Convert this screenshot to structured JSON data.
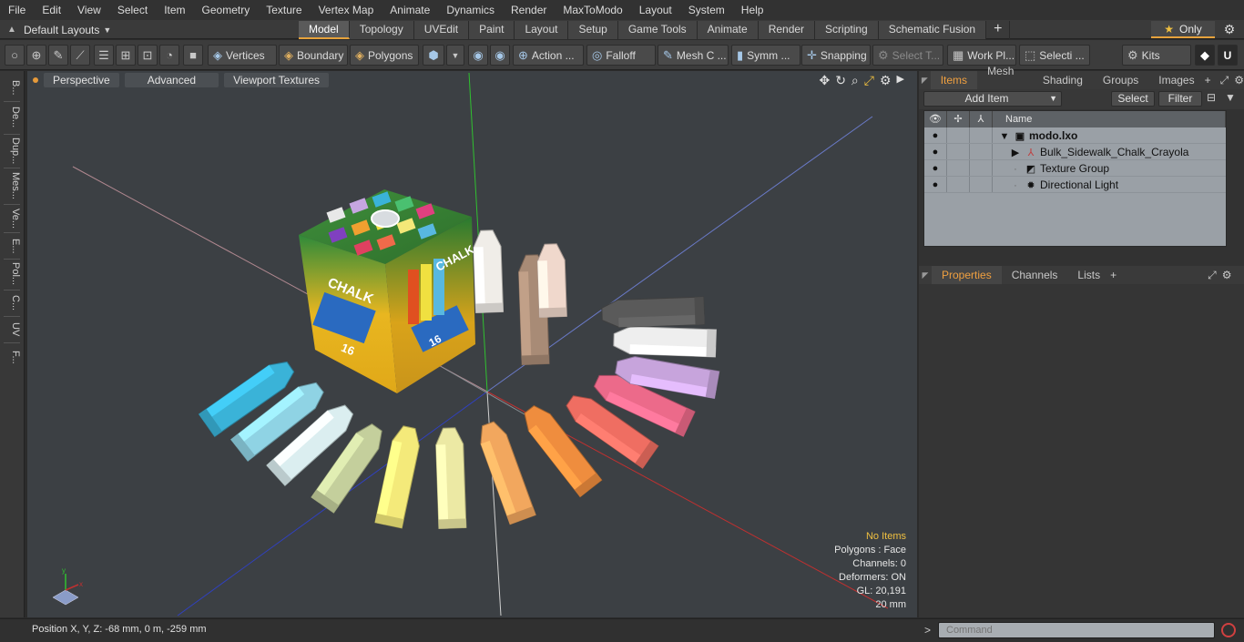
{
  "menu": [
    "File",
    "Edit",
    "View",
    "Select",
    "Item",
    "Geometry",
    "Texture",
    "Vertex Map",
    "Animate",
    "Dynamics",
    "Render",
    "MaxToModo",
    "Layout",
    "System",
    "Help"
  ],
  "layout_selector": "Default Layouts",
  "tabs": [
    "Model",
    "Topology",
    "UVEdit",
    "Paint",
    "Layout",
    "Setup",
    "Game Tools",
    "Animate",
    "Render",
    "Scripting",
    "Schematic Fusion"
  ],
  "active_tab": "Model",
  "only_label": "Only",
  "toolbar": {
    "vertices": "Vertices",
    "boundary": "Boundary",
    "polygons": "Polygons",
    "action": "Action ...",
    "falloff": "Falloff",
    "mesh": "Mesh C ...",
    "symm": "Symm ...",
    "snapping": "Snapping",
    "select_t": "Select T...",
    "work_pl": "Work Pl...",
    "selecti": "Selecti ...",
    "kits": "Kits"
  },
  "left_strip": [
    "B...",
    "De...",
    "Dup...",
    "Mes...",
    "Ve...",
    "E...",
    "Pol...",
    "C...",
    "UV",
    "F..."
  ],
  "viewport": {
    "perspective": "Perspective",
    "advanced": "Advanced",
    "textures": "Viewport Textures"
  },
  "stats": {
    "items": "No Items",
    "polygons": "Polygons : Face",
    "channels": "Channels: 0",
    "deformers": "Deformers: ON",
    "gl": "GL: 20,191",
    "scale": "20 mm"
  },
  "items_panel": {
    "tabs": [
      "Items",
      "Mesh ...",
      "Shading",
      "Groups",
      "Images"
    ],
    "add_item": "Add Item",
    "select": "Select",
    "filter": "Filter",
    "name_header": "Name",
    "rows": [
      {
        "name": "modo.lxo",
        "bold": true
      },
      {
        "name": "Bulk_Sidewalk_Chalk_Crayola",
        "bold": false
      },
      {
        "name": "Texture Group",
        "bold": false
      },
      {
        "name": "Directional Light",
        "bold": false
      }
    ]
  },
  "props_tabs": [
    "Properties",
    "Channels",
    "Lists"
  ],
  "status": "Position X, Y, Z:   -68 mm, 0 m, -259 mm",
  "command_placeholder": "Command",
  "box_text": {
    "chalk": "CHALK",
    "count": "16"
  },
  "colors": {
    "accent": "#e6a23c",
    "viewport_bg": "#3c4044",
    "axis_x": "#c03030",
    "axis_y": "#30c030",
    "axis_z": "#3040c0"
  },
  "chalk_pieces": [
    {
      "name": "blue",
      "color": "#3ab3d8"
    },
    {
      "name": "light-blue",
      "color": "#8fd3e4"
    },
    {
      "name": "white-blue",
      "color": "#dbeef0"
    },
    {
      "name": "sage",
      "color": "#c4cf9c"
    },
    {
      "name": "yellow",
      "color": "#f4ea7a"
    },
    {
      "name": "pale-yellow",
      "color": "#ece9a4"
    },
    {
      "name": "light-orange",
      "color": "#f2a75e"
    },
    {
      "name": "orange",
      "color": "#ef8d3e"
    },
    {
      "name": "coral",
      "color": "#ef6e62"
    },
    {
      "name": "pink",
      "color": "#ec6a8a"
    },
    {
      "name": "lavender",
      "color": "#c7a4dc"
    },
    {
      "name": "white",
      "color": "#eeeeee"
    },
    {
      "name": "gray",
      "color": "#5a5a5a"
    },
    {
      "name": "white-upright",
      "color": "#f0ede8"
    },
    {
      "name": "brown",
      "color": "#a88b76"
    },
    {
      "name": "peach",
      "color": "#f0d8cc"
    }
  ]
}
